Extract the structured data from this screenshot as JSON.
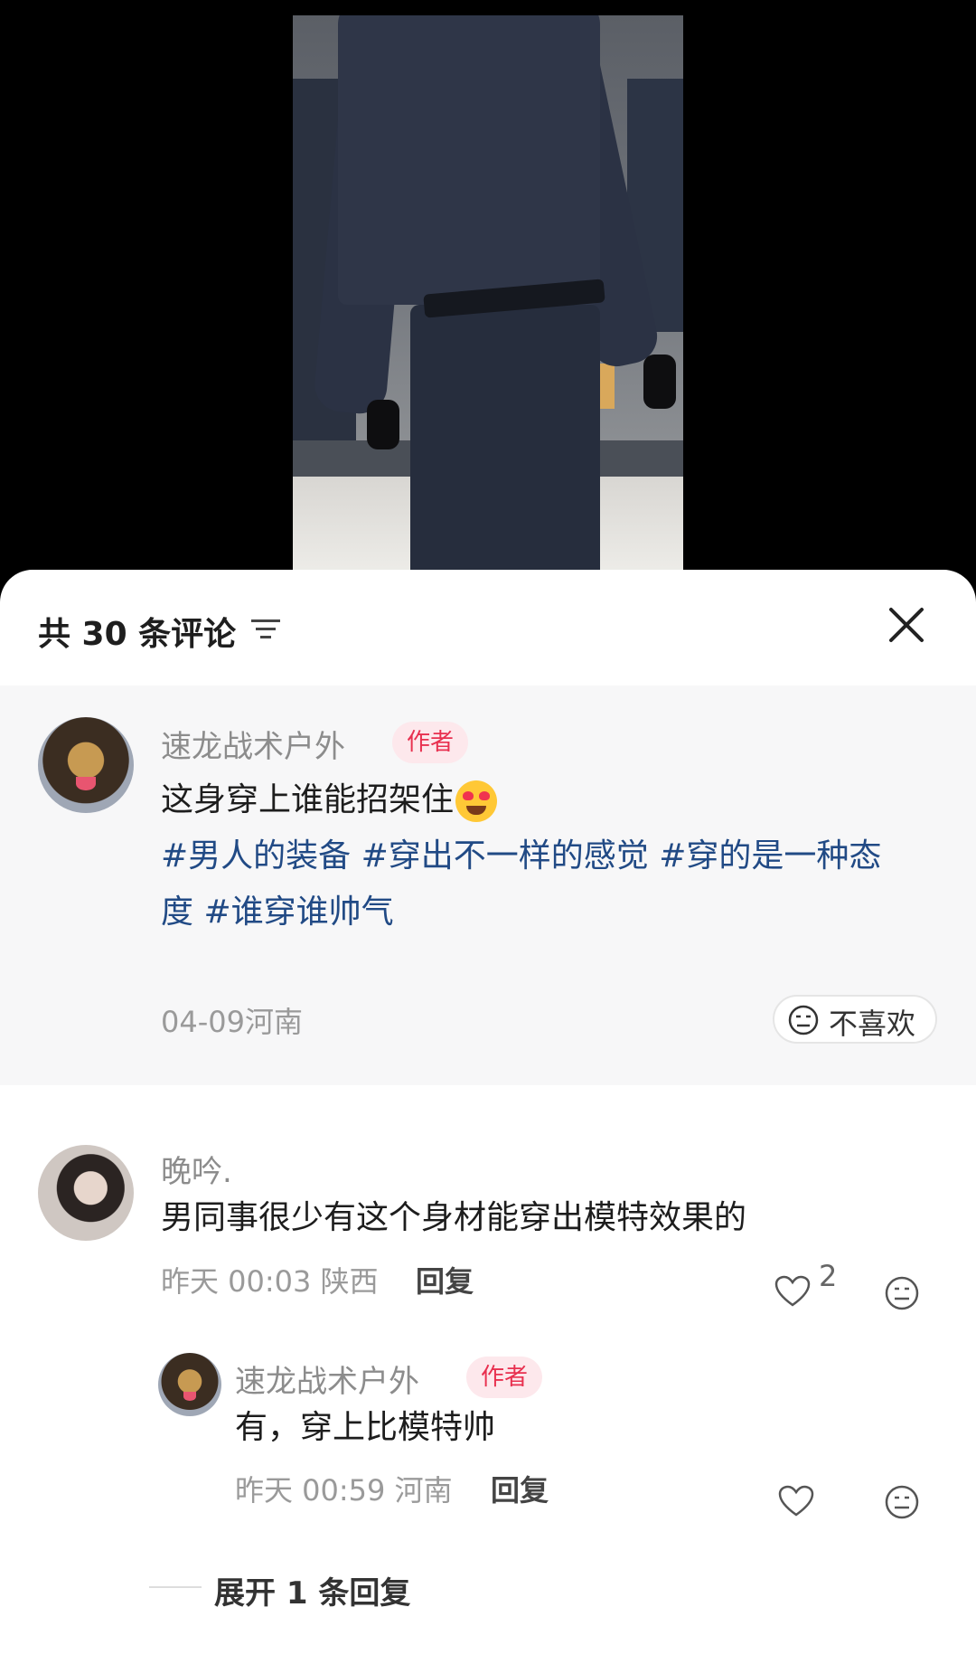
{
  "sheet": {
    "title": "共 30 条评论",
    "sort_icon": "sort-lines-icon",
    "close_icon": "close-icon"
  },
  "pinned_comment": {
    "username": "速龙战术户外",
    "badge": "作者",
    "text": "这身穿上谁能招架住",
    "emoji": "heart-eyes-emoji",
    "tags_line1": "#男人的装备 #穿出不一样的感觉 #穿的是一种态",
    "tags_line2": "度 #谁穿谁帅气",
    "meta": "04-09河南",
    "dislike_label": "不喜欢"
  },
  "comments": [
    {
      "username": "晚吟.",
      "text": "男同事很少有这个身材能穿出模特效果的",
      "time": "昨天 00:03 陕西",
      "reply_label": "回复",
      "likes": "2",
      "replies": [
        {
          "username": "速龙战术户外",
          "badge": "作者",
          "text": "有，穿上比模特帅",
          "time": "昨天 00:59 河南",
          "reply_label": "回复"
        }
      ],
      "expand_label": "展开 1 条回复"
    }
  ],
  "colors": {
    "tag": "#214a85",
    "badge_bg": "#fde8ec",
    "badge_text": "#e8304f",
    "pinned_bg": "#f7f7f8"
  }
}
